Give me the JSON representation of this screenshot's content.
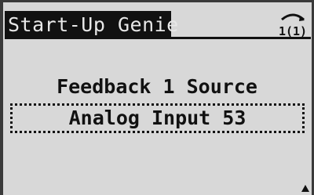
{
  "header": {
    "title": "Start-Up Genie",
    "nav_indicator_icon": "up-down-arrows-icon",
    "nav_indicator_text": "1(1)"
  },
  "parameter": {
    "name": "Feedback 1 Source",
    "value": "Analog Input 53"
  },
  "footer": {
    "scroll_indicator_icon": "up-arrow-icon"
  },
  "colors": {
    "background": "#d8d8d8",
    "foreground": "#111111",
    "title_bar_bg": "#111111",
    "title_bar_fg": "#e8e8e8"
  }
}
